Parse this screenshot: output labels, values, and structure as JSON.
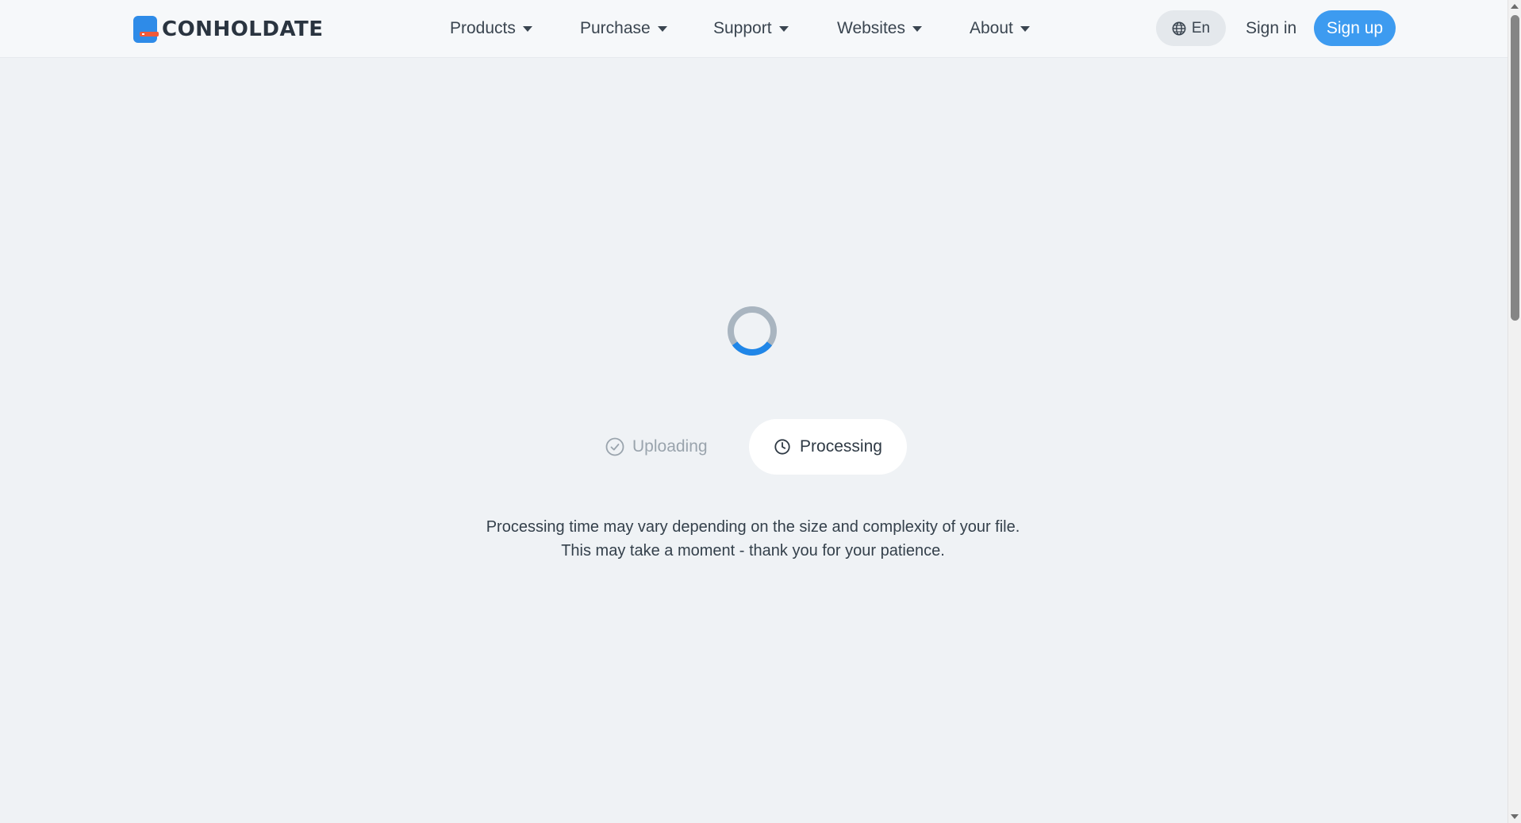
{
  "header": {
    "logo_text": "CONHOLDATE",
    "nav": [
      {
        "label": "Products"
      },
      {
        "label": "Purchase"
      },
      {
        "label": "Support"
      },
      {
        "label": "Websites"
      },
      {
        "label": "About"
      }
    ],
    "language": "En",
    "sign_in": "Sign in",
    "sign_up": "Sign up"
  },
  "progress": {
    "steps": [
      {
        "label": "Uploading",
        "state": "done"
      },
      {
        "label": "Processing",
        "state": "active"
      }
    ],
    "spinner_fill": 0.3
  },
  "message": {
    "line1": "Processing time may vary depending on the size and complexity of your file.",
    "line2": "This may take a moment - thank you for your patience."
  },
  "colors": {
    "accent": "#3d9bf0",
    "spinner_track": "#a9b5c0",
    "spinner_arc": "#1f86e8",
    "background": "#eff2f5"
  },
  "icons": {
    "logo": "conholdate-logo-icon",
    "language": "globe-icon",
    "uploading": "check-circle-icon",
    "processing": "clock-icon"
  }
}
